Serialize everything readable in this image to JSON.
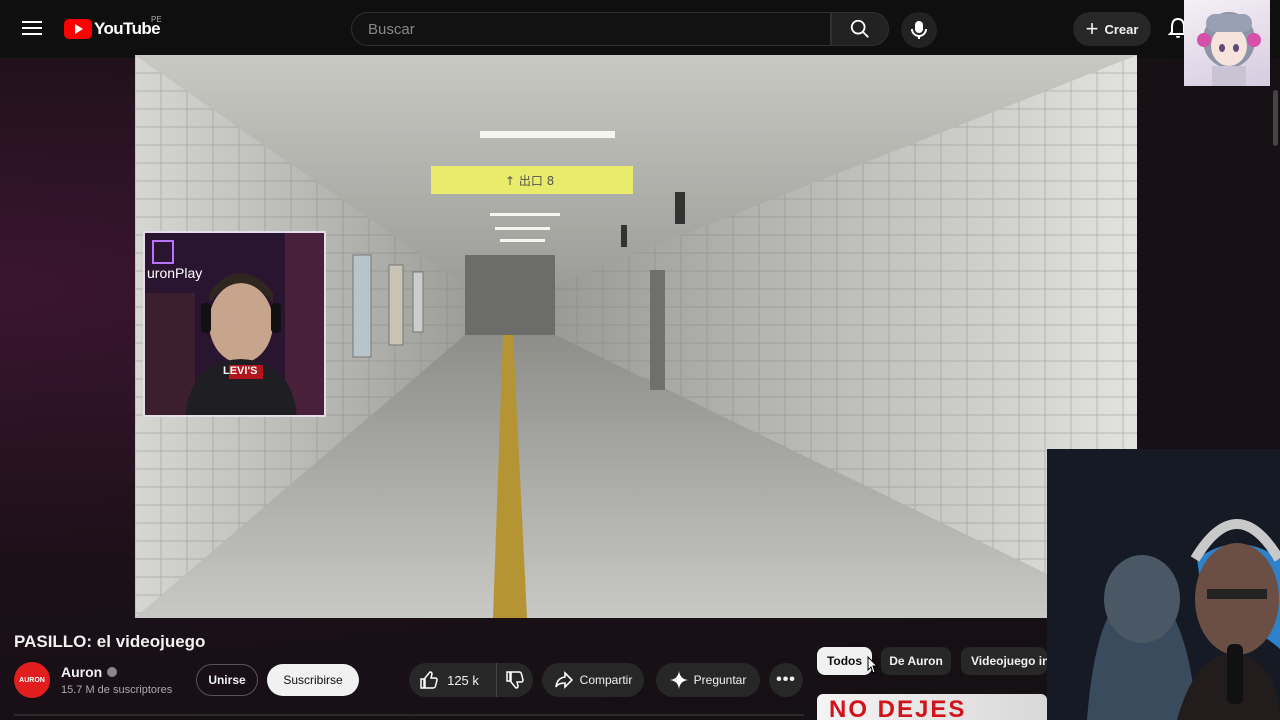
{
  "header": {
    "logo_text": "YouTube",
    "country_code": "PE",
    "search_placeholder": "Buscar",
    "create_label": "Crear"
  },
  "video": {
    "sign_text": "↑ 出口 8",
    "streamer_overlay_text": "uronPlay",
    "shirt_text": "LEVI'S"
  },
  "info": {
    "title": "PASILLO: el videojuego",
    "channel_avatar_text": "AURON",
    "channel_name": "Auron",
    "subscribers": "15.7 M de suscriptores",
    "join_label": "Unirse",
    "subscribe_label": "Suscribirse",
    "likes": "125 k",
    "share_label": "Compartir",
    "ask_label": "Preguntar",
    "more_label": "•••"
  },
  "chips": [
    "Todos",
    "De Auron",
    "Videojuego in"
  ],
  "thumbnail_text": "NO DEJES"
}
